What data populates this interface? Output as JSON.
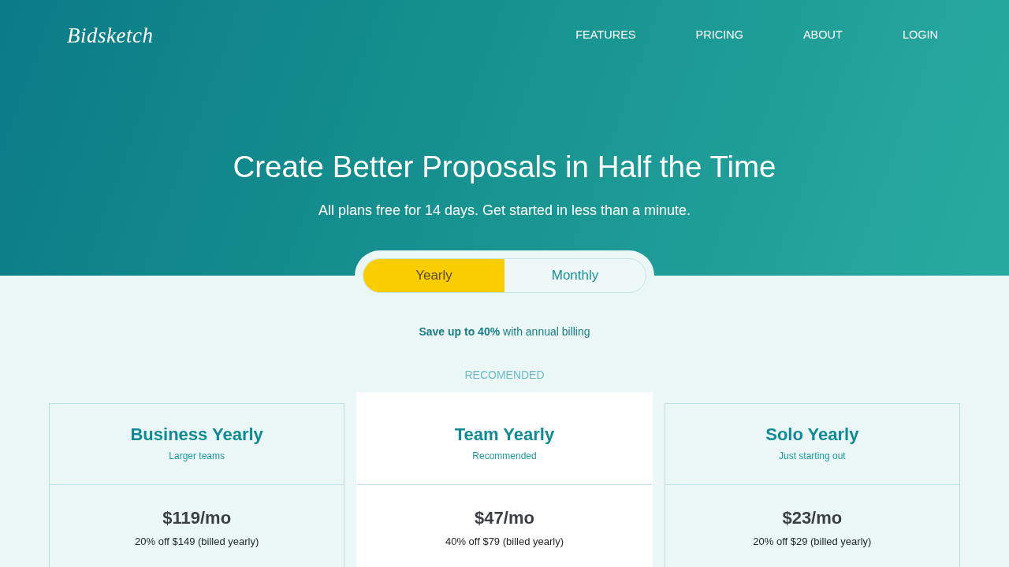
{
  "header": {
    "logo": "Bidsketch",
    "nav": [
      {
        "label": "FEATURES"
      },
      {
        "label": "PRICING"
      },
      {
        "label": "ABOUT"
      },
      {
        "label": "LOGIN"
      }
    ]
  },
  "hero": {
    "title": "Create Better Proposals in Half the Time",
    "subtitle": "All plans free for 14 days. Get started in less than a minute."
  },
  "billing_toggle": [
    {
      "label": "Yearly",
      "selected": true
    },
    {
      "label": "Monthly",
      "selected": false
    }
  ],
  "savings_note": "**Save up to 40%** with annual billing",
  "recommended_label": "RECOMENDED",
  "plans": [
    {
      "name": "Business Yearly",
      "tagline": "Larger teams",
      "price": "$119/mo",
      "price_note": "20% off $149 (billed yearly)",
      "highlighted": false
    },
    {
      "name": "Team Yearly",
      "tagline": "Recommended",
      "price": "$47/mo",
      "price_note": "40% off $79 (billed yearly)",
      "highlighted": true
    },
    {
      "name": "Solo Yearly",
      "tagline": "Just starting out",
      "price": "$23/mo",
      "price_note": "20% off $29 (billed yearly)",
      "highlighted": false
    }
  ]
}
